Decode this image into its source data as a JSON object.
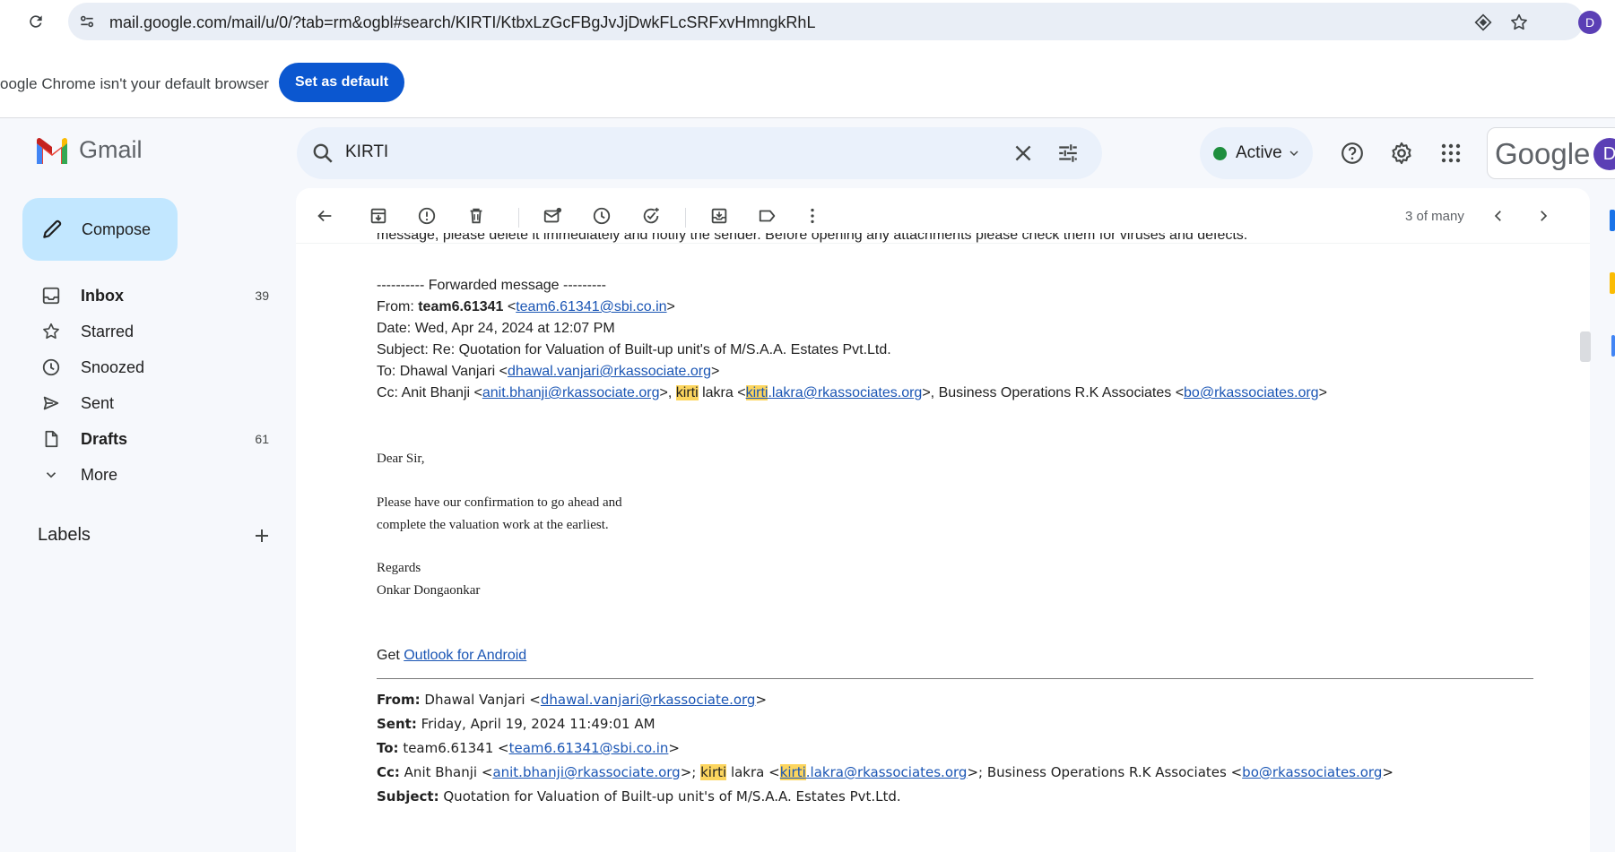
{
  "browser": {
    "url": "mail.google.com/mail/u/0/?tab=rm&ogbl#search/KIRTI/KtbxLzGcFBgJvJjDwkFLcSRFxvHmngkRhL",
    "profile_initial": "D"
  },
  "infobar": {
    "text": "oogle Chrome isn't your default browser",
    "button": "Set as default"
  },
  "header": {
    "app_name": "Gmail",
    "search_query": "KIRTI",
    "status": "Active",
    "google_word": "Google",
    "account_initial": "D"
  },
  "sidebar": {
    "compose": "Compose",
    "items": [
      {
        "label": "Inbox",
        "count": "39",
        "icon": "inbox-icon"
      },
      {
        "label": "Starred",
        "count": "",
        "icon": "star-icon"
      },
      {
        "label": "Snoozed",
        "count": "",
        "icon": "clock-icon"
      },
      {
        "label": "Sent",
        "count": "",
        "icon": "send-icon"
      },
      {
        "label": "Drafts",
        "count": "61",
        "icon": "draft-icon"
      },
      {
        "label": "More",
        "count": "",
        "icon": "chevron-down-icon"
      }
    ],
    "labels_title": "Labels"
  },
  "toolbar": {
    "page_count": "3 of many"
  },
  "message": {
    "top_line": "message, please delete it immediately and notify the sender. Before opening any attachments please check them for viruses and defects.",
    "fwd_header": "---------- Forwarded message ---------",
    "fwd_from_label": "From: ",
    "fwd_from_name": "team6.61341",
    "fwd_from_email": "team6.61341@sbi.co.in",
    "fwd_date": "Date: Wed, Apr 24, 2024 at 12:07 PM",
    "fwd_subject": "Subject: Re: Quotation for Valuation of Built-up unit's of M/S.A.A. Estates Pvt.Ltd.",
    "fwd_to_prefix": "To: Dhawal Vanjari <",
    "fwd_to_email": "dhawal.vanjari@rkassociate.org",
    "fwd_cc_prefix": "Cc: Anit Bhanji <",
    "fwd_cc_email1": "anit.bhanji@rkassociate.org",
    "cc_highlight": "kirti",
    "cc_lakra": " lakra <",
    "cc_email2_rest": ".lakra@rkassociates.org",
    "cc_bo_text": ">, Business Operations R.K Associates <",
    "cc_bo_email": "bo@rkassociates.org",
    "greeting": "Dear Sir,",
    "body_1": "Please have our confirmation to go ahead and",
    "body_2": "complete the valuation work at the earliest.",
    "regards": "Regards",
    "signature": "Onkar Dongaonkar",
    "get_text": "Get ",
    "outlook_link": "Outlook for Android",
    "orig_from_label": "From:",
    "orig_from_name": " Dhawal Vanjari <",
    "orig_from_email": "dhawal.vanjari@rkassociate.org",
    "orig_sent_label": "Sent:",
    "orig_sent": " Friday, April 19, 2024 11:49:01 AM",
    "orig_to_label": "To:",
    "orig_to_name": " team6.61341 <",
    "orig_to_email": "team6.61341@sbi.co.in",
    "orig_cc_label": "Cc:",
    "orig_cc_name": " Anit Bhanji <",
    "orig_cc_email1": "anit.bhanji@rkassociate.org",
    "orig_cc_sep": ">; ",
    "orig_cc_bo_text": ">; Business Operations R.K Associates <",
    "orig_subject_label": "Subject:",
    "orig_subject": " Quotation for Valuation of Built-up unit's of M/S.A.A. Estates Pvt.Ltd."
  }
}
